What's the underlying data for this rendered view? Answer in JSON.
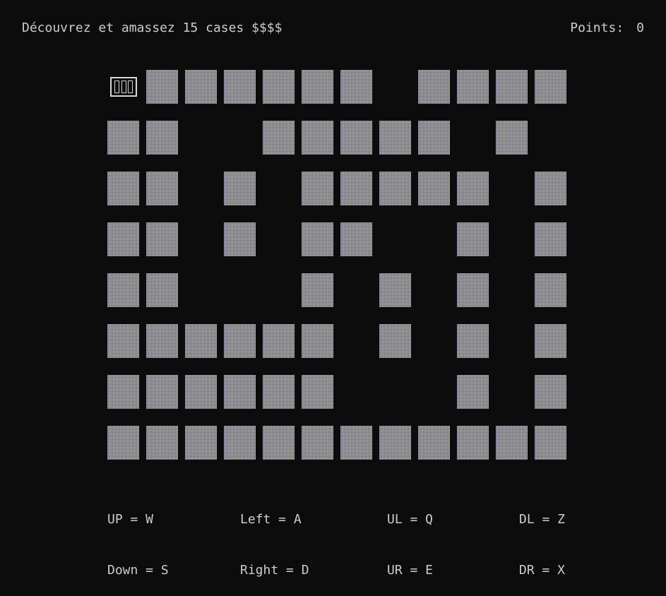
{
  "header": {
    "instruction": "Découvrez et amassez 15 cases $$$$",
    "points_label": "Points:",
    "points_value": "0"
  },
  "board": {
    "rows": 8,
    "cols": 12,
    "player": {
      "row": 0,
      "col": 0
    },
    "grid": [
      "P11111101111",
      "110011111010",
      "110101111101",
      "110101100101",
      "110001010101",
      "111111010101",
      "111111000101",
      "111111111111"
    ],
    "colors": {
      "background": "#0c0c0c",
      "tile": "#c6c6c6",
      "text": "#cccccc"
    }
  },
  "controls": {
    "up": "UP = W",
    "down": "Down = S",
    "left": "Left = A",
    "right": "Right = D",
    "ul": "UL = Q",
    "ur": "UR = E",
    "dl": "DL = Z",
    "dr": "DR = X"
  }
}
